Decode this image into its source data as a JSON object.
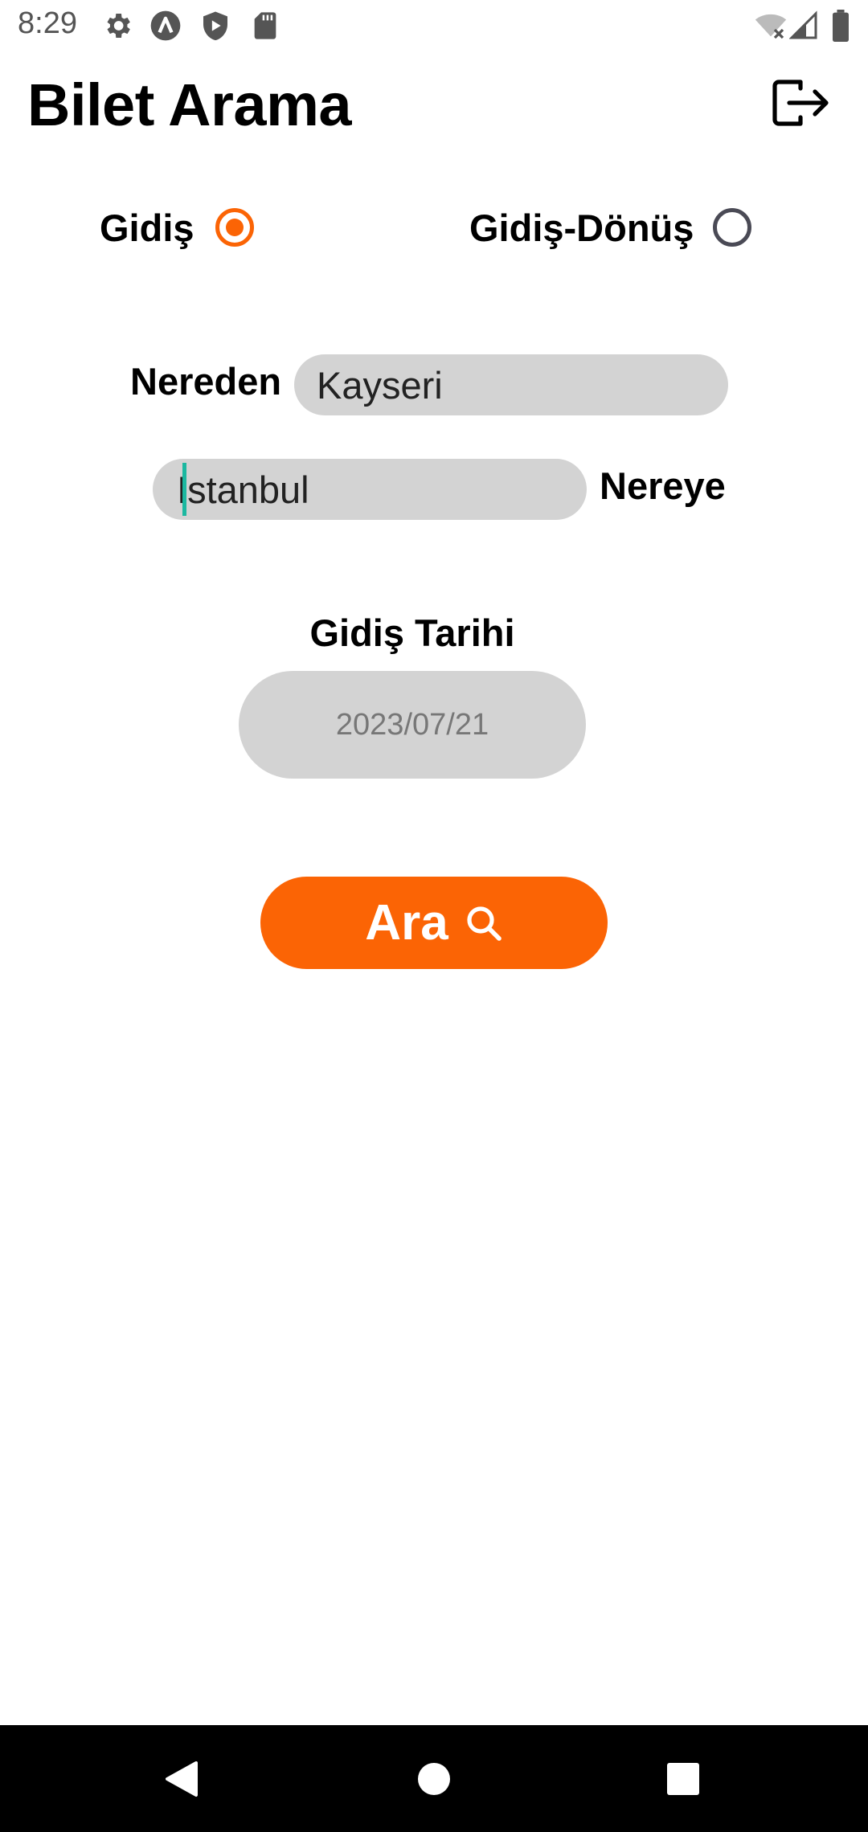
{
  "status_bar": {
    "time": "8:29",
    "icons_left": [
      "settings-gear-icon",
      "app-a-icon",
      "shield-play-icon",
      "sd-card-icon"
    ],
    "icons_right": [
      "wifi-off-icon",
      "cell-signal-icon",
      "battery-icon"
    ]
  },
  "header": {
    "title": "Bilet Arama",
    "logout_icon": "logout-icon"
  },
  "trip_type": {
    "options": [
      {
        "label": "Gidiş",
        "selected": true
      },
      {
        "label": "Gidiş-Dönüş",
        "selected": false
      }
    ]
  },
  "form": {
    "from_label": "Nereden",
    "from_value": "Kayseri",
    "to_label": "Nereye",
    "to_value_prefix": "I",
    "to_value_suffix": "stanbul",
    "date_label": "Gidiş Tarihi",
    "date_value": "2023/07/21"
  },
  "search_button": {
    "label": "Ara",
    "icon": "search-icon"
  },
  "colors": {
    "accent": "#fb6405",
    "field_bg": "#d3d3d3",
    "caret": "#1bb8a0"
  },
  "nav_bar": {
    "buttons": [
      "back-icon",
      "home-icon",
      "recents-icon"
    ]
  }
}
